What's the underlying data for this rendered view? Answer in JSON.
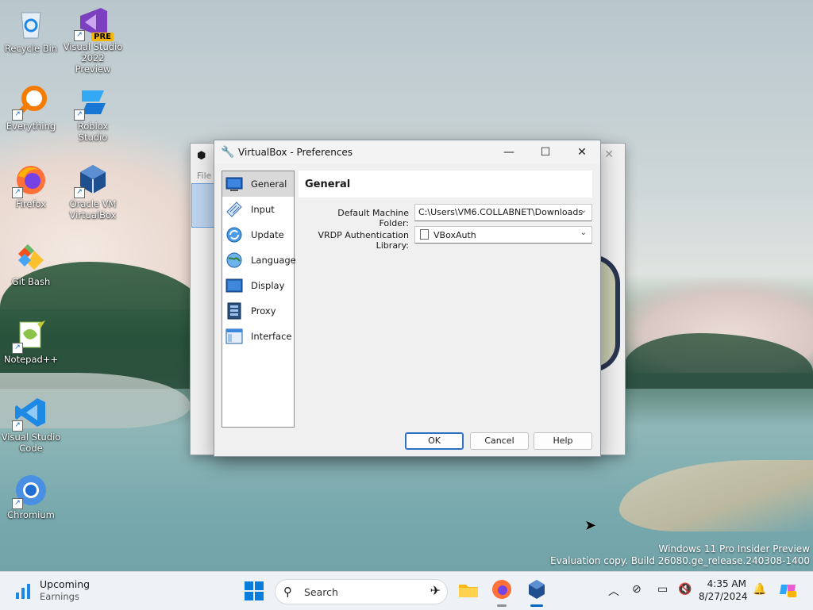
{
  "desktop": {
    "icons": [
      {
        "label": "Recycle Bin"
      },
      {
        "label": "Visual Studio 2022 Preview",
        "badge": "PRE"
      },
      {
        "label": "Everything"
      },
      {
        "label": "Roblox Studio"
      },
      {
        "label": "Firefox"
      },
      {
        "label": "Oracle VM VirtualBox"
      },
      {
        "label": "Git Bash"
      },
      {
        "label": "Notepad++"
      },
      {
        "label": "Visual Studio Code"
      },
      {
        "label": "Chromium"
      }
    ],
    "watermark_line1": "Windows 11 Pro Insider Preview",
    "watermark_line2": "Evaluation copy. Build 26080.ge_release.240308-1400"
  },
  "background_window": {
    "menu_label": "File"
  },
  "dialog": {
    "title": "VirtualBox - Preferences",
    "sidebar": {
      "items": [
        {
          "label": "General",
          "icon": "general-icon",
          "selected": true
        },
        {
          "label": "Input",
          "icon": "input-icon"
        },
        {
          "label": "Update",
          "icon": "update-icon"
        },
        {
          "label": "Language",
          "icon": "language-icon"
        },
        {
          "label": "Display",
          "icon": "display-icon"
        },
        {
          "label": "Proxy",
          "icon": "proxy-icon"
        },
        {
          "label": "Interface",
          "icon": "interface-icon"
        }
      ]
    },
    "section_title": "General",
    "fields": {
      "machine_folder_label": "Default Machine Folder:",
      "machine_folder_value": "C:\\Users\\VM6.COLLABNET\\Downloads",
      "vrdp_label": "VRDP Authentication Library:",
      "vrdp_value": "VBoxAuth"
    },
    "buttons": {
      "ok": "OK",
      "cancel": "Cancel",
      "help": "Help"
    }
  },
  "taskbar": {
    "weather_title": "Upcoming",
    "weather_subtitle": "Earnings",
    "search_placeholder": "Search",
    "clock_time": "4:35 AM",
    "clock_date": "8/27/2024",
    "accent": "#0067c0"
  }
}
